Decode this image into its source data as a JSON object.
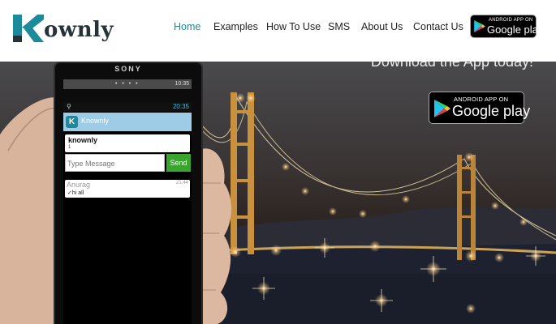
{
  "brand": {
    "logo_letter": "K",
    "logo_rest": "ownly"
  },
  "nav": {
    "items": [
      {
        "label": "Home",
        "active": true
      },
      {
        "label": "Examples",
        "active": false
      },
      {
        "label": "How To Use",
        "active": false
      },
      {
        "label": "SMS",
        "active": false
      },
      {
        "label": "About Us",
        "active": false
      },
      {
        "label": "Contact Us",
        "active": false
      }
    ]
  },
  "store_badge": {
    "small": "ANDROID APP ON",
    "big": "Google play"
  },
  "hero": {
    "headline": "Download the App today!"
  },
  "phone": {
    "brand": "SONY",
    "status_time_1": "10:35",
    "status_time_2": "20:35",
    "app_title": "Knownly",
    "contact_name": "knownly",
    "contact_count": "1",
    "message_placeholder": "Type Message",
    "send_label": "Send",
    "msg_sender": "Anurag",
    "msg_time": "21:44",
    "msg_text": "hi all"
  },
  "colors": {
    "accent": "#1b8a9a",
    "app_bar": "#9ecbe6",
    "send": "#39a52f"
  }
}
